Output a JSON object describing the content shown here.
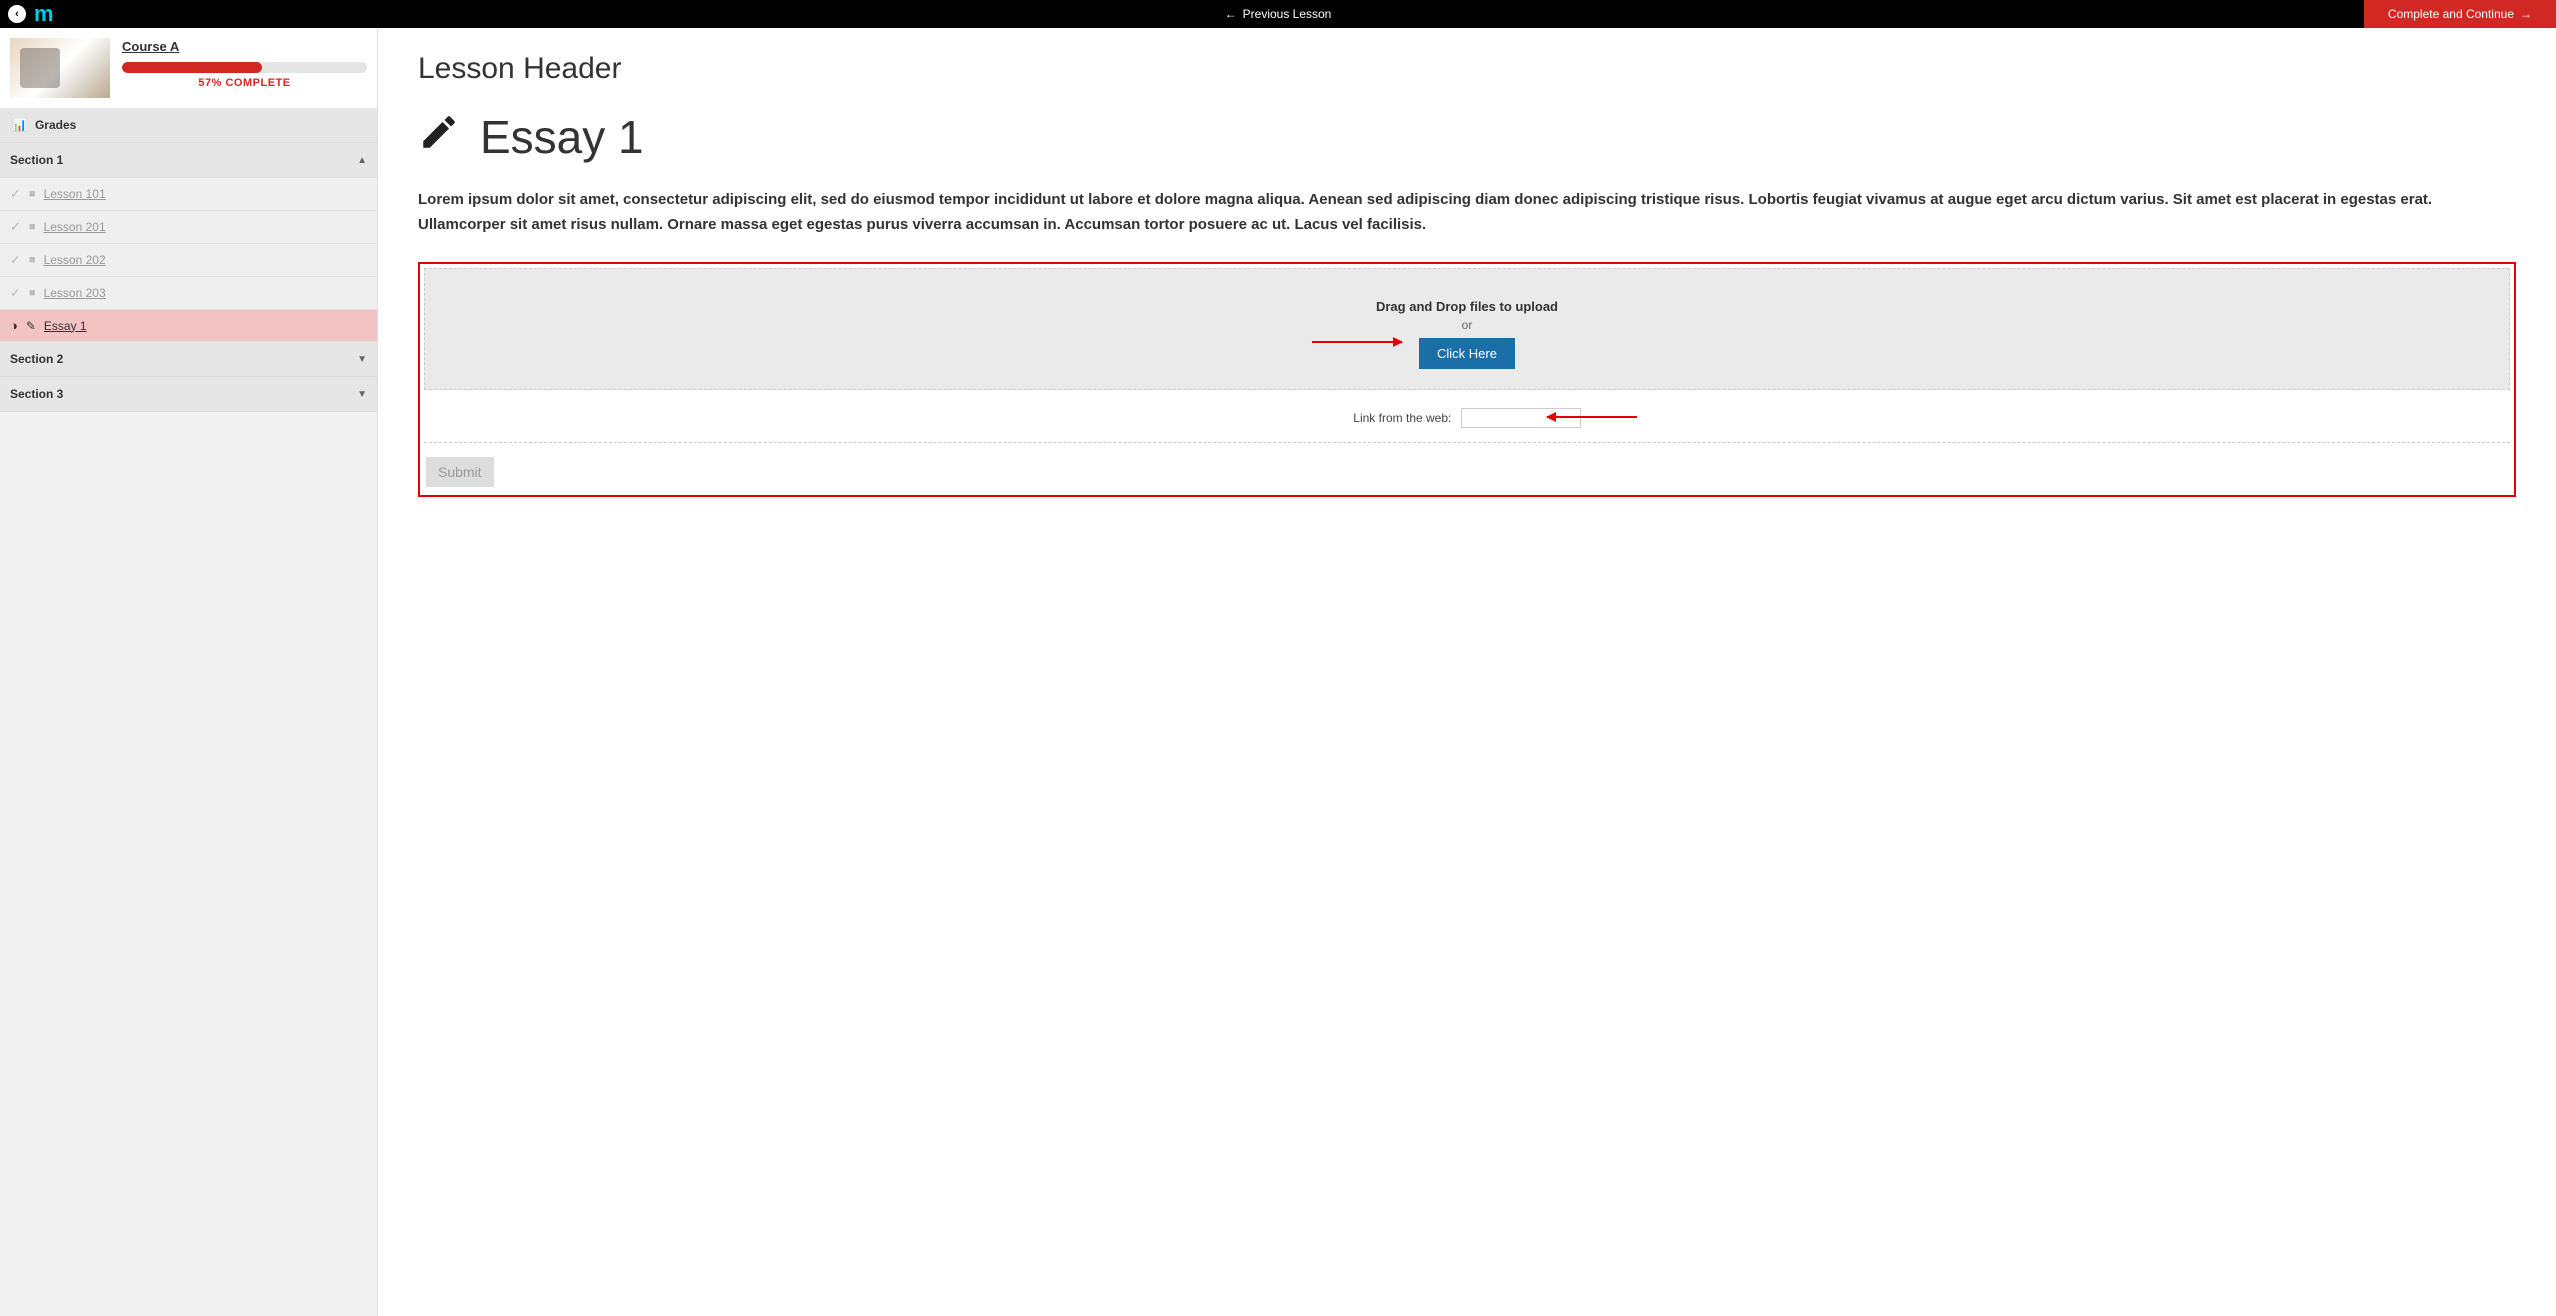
{
  "topbar": {
    "prev_label": "Previous Lesson",
    "complete_label": "Complete and Continue"
  },
  "course": {
    "title": "Course A",
    "progress_pct": 57,
    "progress_label": "57% COMPLETE"
  },
  "sidebar": {
    "grades_label": "Grades",
    "sections": [
      {
        "label": "Section 1",
        "expanded": true,
        "lessons": [
          {
            "label": "Lesson 101",
            "icon": "file",
            "done": true
          },
          {
            "label": "Lesson 201",
            "icon": "file",
            "done": true
          },
          {
            "label": "Lesson 202",
            "icon": "file",
            "done": true
          },
          {
            "label": "Lesson 203",
            "icon": "file",
            "done": true
          },
          {
            "label": "Essay 1",
            "icon": "pencil",
            "active": true
          }
        ]
      },
      {
        "label": "Section 2",
        "expanded": false,
        "lessons": []
      },
      {
        "label": "Section 3",
        "expanded": false,
        "lessons": []
      }
    ]
  },
  "main": {
    "lesson_header": "Lesson Header",
    "essay_title": "Essay 1",
    "body": "Lorem ipsum dolor sit amet, consectetur adipiscing elit, sed do eiusmod tempor incididunt ut labore et dolore magna aliqua. Aenean sed adipiscing diam donec adipiscing tristique risus. Lobortis feugiat vivamus at augue eget arcu dictum varius. Sit amet est placerat in egestas erat. Ullamcorper sit amet risus nullam. Ornare massa eget egestas purus viverra accumsan in. Accumsan tortor posuere ac ut. Lacus vel facilisis.",
    "upload": {
      "drop_title": "Drag and Drop files to upload",
      "drop_sub": "or",
      "click_label": "Click Here",
      "link_label": "Link from the web:",
      "link_value": "",
      "submit_label": "Submit"
    }
  }
}
